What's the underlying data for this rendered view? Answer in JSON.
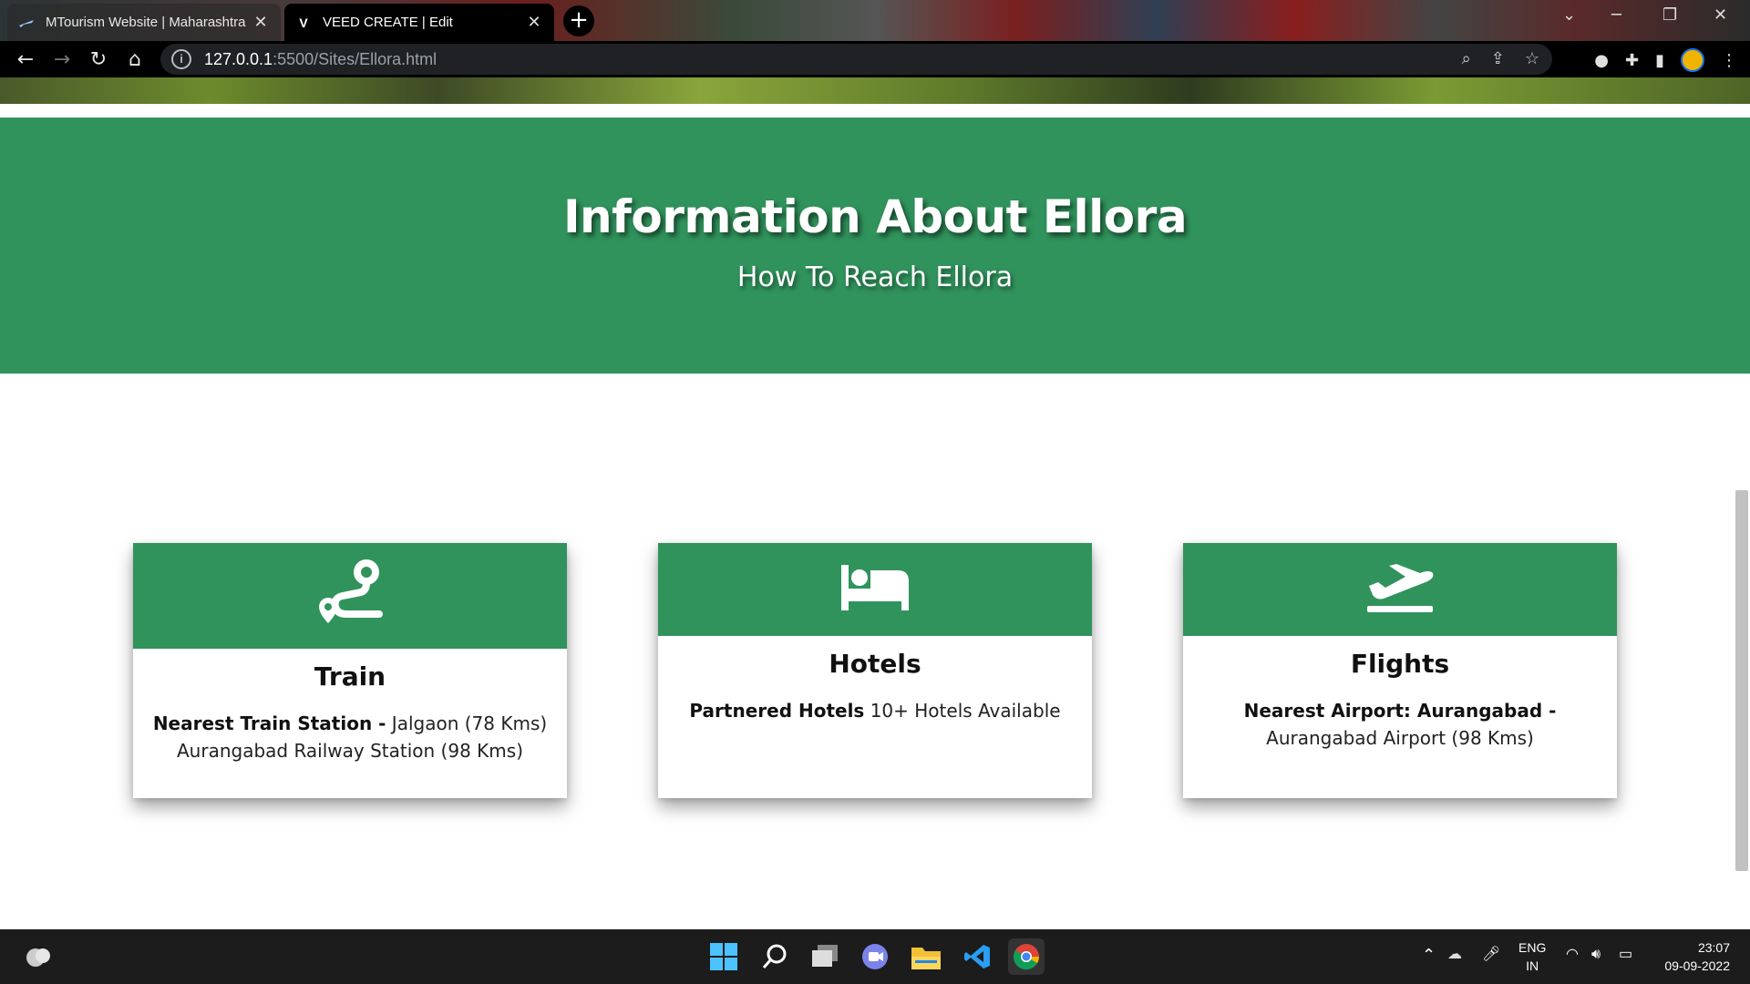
{
  "browser": {
    "tabs": [
      {
        "title": "MTourism Website | Maharashtra",
        "active": false
      },
      {
        "title": "VEED CREATE | Edit",
        "active": true
      }
    ],
    "new_tab_label": "+",
    "url_host": "127.0.0.1",
    "url_path": ":5500/Sites/Ellora.html"
  },
  "page": {
    "heading": "Information About Ellora",
    "subheading": "How To Reach Ellora",
    "accent_color": "#30935c",
    "cards": [
      {
        "icon": "route-icon",
        "title": "Train",
        "label": "Nearest Train Station -",
        "text": " Jalgaon (78 Kms) Aurangabad Railway Station (98 Kms)"
      },
      {
        "icon": "bed-icon",
        "title": "Hotels",
        "label": "Partnered Hotels",
        "text": " 10+ Hotels Available"
      },
      {
        "icon": "plane-departure-icon",
        "title": "Flights",
        "label": "Nearest Airport: Aurangabad -",
        "text": " Aurangabad Airport (98 Kms)"
      }
    ]
  },
  "taskbar": {
    "lang_top": "ENG",
    "lang_bottom": "IN",
    "time": "23:07",
    "date": "09-09-2022"
  }
}
